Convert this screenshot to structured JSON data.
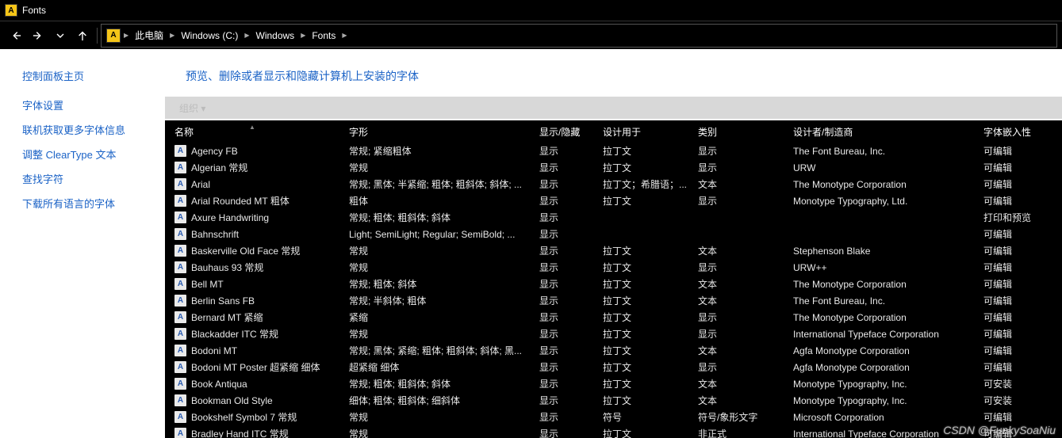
{
  "window": {
    "title": "Fonts"
  },
  "breadcrumbs": {
    "root_icon": "A",
    "items": [
      "此电脑",
      "Windows (C:)",
      "Windows",
      "Fonts"
    ]
  },
  "sidebar": {
    "title": "控制面板主页",
    "links": [
      "字体设置",
      "联机获取更多字体信息",
      "调整 ClearType 文本",
      "查找字符",
      "下载所有语言的字体"
    ]
  },
  "main": {
    "title": "预览、删除或者显示和隐藏计算机上安装的字体",
    "toolbar_hint": "组织 ▾"
  },
  "columns": {
    "name": "名称",
    "style": "字形",
    "hide": "显示/隐藏",
    "design": "设计用于",
    "category": "类别",
    "maker": "设计者/制造商",
    "embed": "字体嵌入性"
  },
  "fonts": [
    {
      "name": "Agency FB",
      "style": "常规; 紧缩粗体",
      "hide": "显示",
      "design": "拉丁文",
      "cat": "显示",
      "maker": "The Font Bureau, Inc.",
      "embed": "可编辑"
    },
    {
      "name": "Algerian 常规",
      "style": "常规",
      "hide": "显示",
      "design": "拉丁文",
      "cat": "显示",
      "maker": "URW",
      "embed": "可编辑"
    },
    {
      "name": "Arial",
      "style": "常规; 黑体; 半紧缩; 粗体; 粗斜体; 斜体; ...",
      "hide": "显示",
      "design": "拉丁文；希腊语；...",
      "cat": "文本",
      "maker": "The Monotype Corporation",
      "embed": "可编辑"
    },
    {
      "name": "Arial Rounded MT 粗体",
      "style": "粗体",
      "hide": "显示",
      "design": "拉丁文",
      "cat": "显示",
      "maker": "Monotype Typography, Ltd.",
      "embed": "可编辑"
    },
    {
      "name": "Axure Handwriting",
      "style": "常规; 粗体; 粗斜体; 斜体",
      "hide": "显示",
      "design": "",
      "cat": "",
      "maker": "",
      "embed": "打印和预览"
    },
    {
      "name": "Bahnschrift",
      "style": "Light; SemiLight; Regular; SemiBold; ...",
      "hide": "显示",
      "design": "",
      "cat": "",
      "maker": "",
      "embed": "可编辑"
    },
    {
      "name": "Baskerville Old Face 常规",
      "style": "常规",
      "hide": "显示",
      "design": "拉丁文",
      "cat": "文本",
      "maker": "Stephenson Blake",
      "embed": "可编辑"
    },
    {
      "name": "Bauhaus 93 常规",
      "style": "常规",
      "hide": "显示",
      "design": "拉丁文",
      "cat": "显示",
      "maker": "URW++",
      "embed": "可编辑"
    },
    {
      "name": "Bell MT",
      "style": "常规; 粗体; 斜体",
      "hide": "显示",
      "design": "拉丁文",
      "cat": "文本",
      "maker": "The Monotype Corporation",
      "embed": "可编辑"
    },
    {
      "name": "Berlin Sans FB",
      "style": "常规; 半斜体; 粗体",
      "hide": "显示",
      "design": "拉丁文",
      "cat": "文本",
      "maker": "The Font Bureau, Inc.",
      "embed": "可编辑"
    },
    {
      "name": "Bernard MT 紧缩",
      "style": "紧缩",
      "hide": "显示",
      "design": "拉丁文",
      "cat": "显示",
      "maker": "The Monotype Corporation",
      "embed": "可编辑"
    },
    {
      "name": "Blackadder ITC 常规",
      "style": "常规",
      "hide": "显示",
      "design": "拉丁文",
      "cat": "显示",
      "maker": "International Typeface Corporation",
      "embed": "可编辑"
    },
    {
      "name": "Bodoni MT",
      "style": "常规; 黑体; 紧缩; 粗体; 粗斜体; 斜体; 黑...",
      "hide": "显示",
      "design": "拉丁文",
      "cat": "文本",
      "maker": "Agfa Monotype Corporation",
      "embed": "可编辑"
    },
    {
      "name": "Bodoni MT Poster 超紧缩 细体",
      "style": "超紧缩 细体",
      "hide": "显示",
      "design": "拉丁文",
      "cat": "显示",
      "maker": "Agfa Monotype Corporation",
      "embed": "可编辑"
    },
    {
      "name": "Book Antiqua",
      "style": "常规; 粗体; 粗斜体; 斜体",
      "hide": "显示",
      "design": "拉丁文",
      "cat": "文本",
      "maker": "Monotype Typography, Inc.",
      "embed": "可安装"
    },
    {
      "name": "Bookman Old Style",
      "style": "细体; 粗体; 粗斜体; 细斜体",
      "hide": "显示",
      "design": "拉丁文",
      "cat": "文本",
      "maker": "Monotype Typography, Inc.",
      "embed": "可安装"
    },
    {
      "name": "Bookshelf Symbol 7 常规",
      "style": "常规",
      "hide": "显示",
      "design": "符号",
      "cat": "符号/象形文字",
      "maker": "Microsoft Corporation",
      "embed": "可编辑"
    },
    {
      "name": "Bradley Hand ITC 常规",
      "style": "常规",
      "hide": "显示",
      "design": "拉丁文",
      "cat": "非正式",
      "maker": "International Typeface Corporation",
      "embed": "可编辑"
    }
  ],
  "watermark": "CSDN @FunkySoaNiu"
}
